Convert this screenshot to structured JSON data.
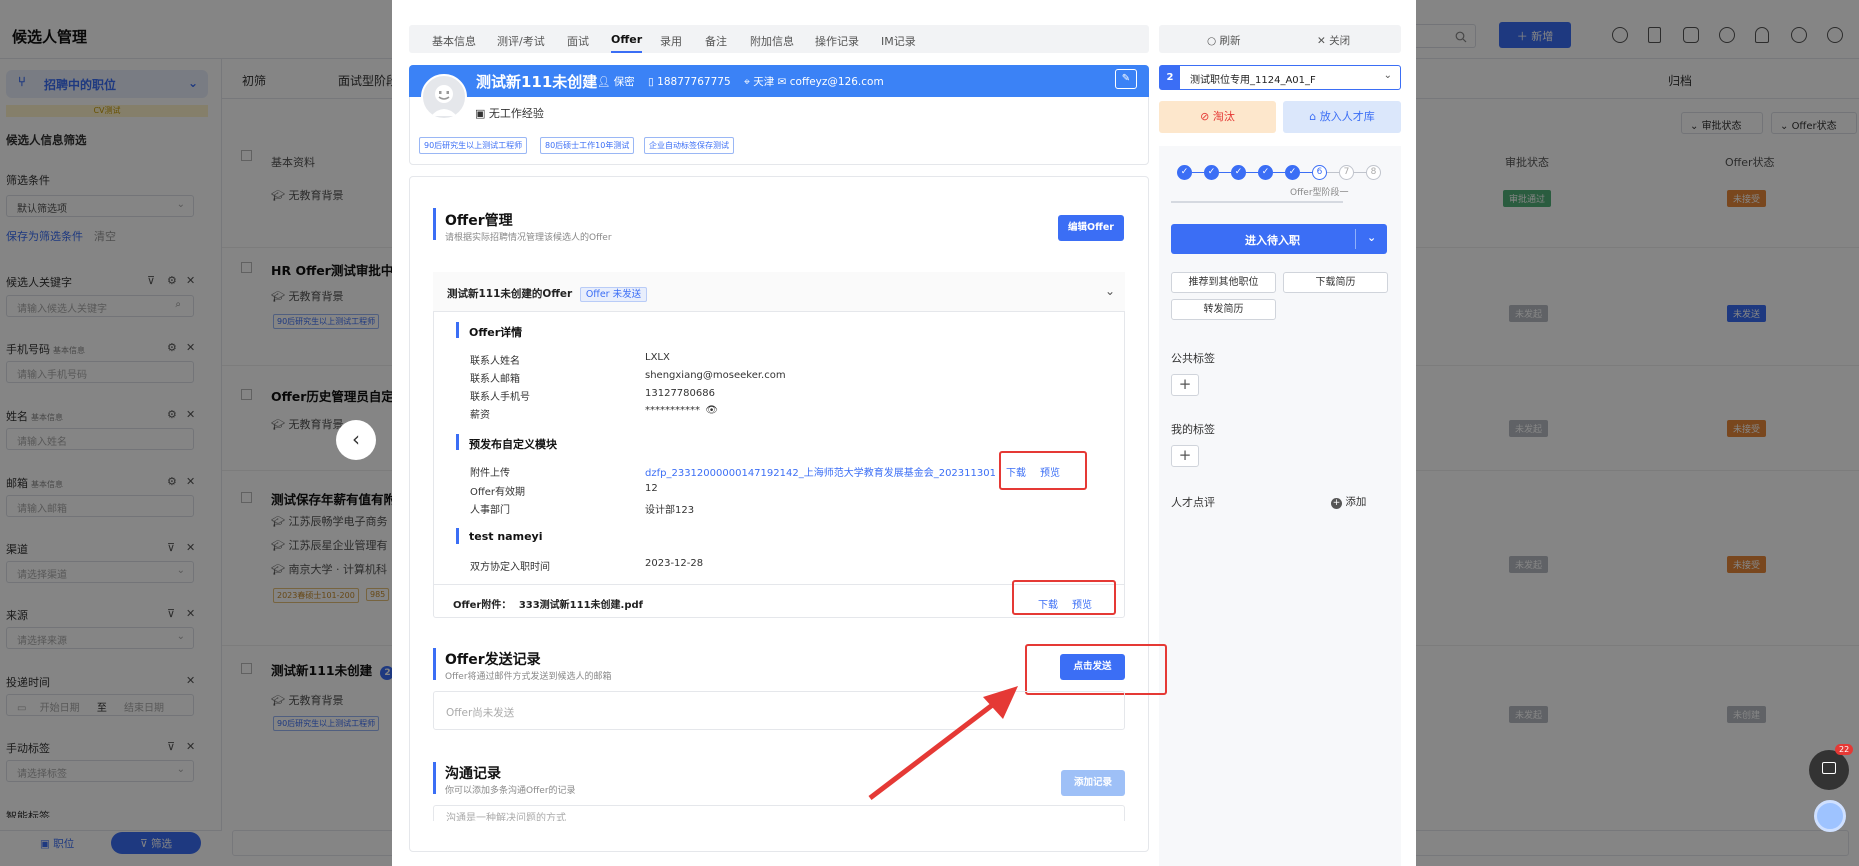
{
  "app": {
    "title": "候选人管理"
  },
  "header_right": {
    "new_button": "新增"
  },
  "sidebar": {
    "job_select": "招聘中的职位",
    "cv_tag": "CV测试",
    "section_title": "候选人信息筛选",
    "filter_condition_label": "筛选条件",
    "filter_default": "默认筛选项",
    "save_filter": "保存为筛选条件",
    "clear": "清空",
    "fields": [
      {
        "label": "候选人关键字",
        "small": "",
        "placeholder": "请输入候选人关键字"
      },
      {
        "label": "手机号码",
        "small": "基本信息",
        "placeholder": "请输入手机号码"
      },
      {
        "label": "姓名",
        "small": "基本信息",
        "placeholder": "请输入姓名"
      },
      {
        "label": "邮箱",
        "small": "基本信息",
        "placeholder": "请输入邮箱"
      },
      {
        "label": "渠道",
        "small": "",
        "placeholder": "请选择渠道"
      },
      {
        "label": "来源",
        "small": "",
        "placeholder": "请选择来源"
      },
      {
        "label": "投递时间",
        "small": "",
        "placeholder": ""
      },
      {
        "label": "手动标签",
        "small": "",
        "placeholder": "请选择标签"
      },
      {
        "label": "智能标签",
        "small": "",
        "placeholder": ""
      }
    ],
    "date_start": "开始日期",
    "date_to": "至",
    "date_end": "结束日期",
    "nav_job": "职位",
    "nav_filter": "筛选"
  },
  "pipeline": {
    "stage1": "初筛",
    "stage2": "面试型阶段",
    "archive": "归档"
  },
  "list": {
    "col_basic": "基本资料",
    "col_approval": "审批状态",
    "col_offer": "Offer状态",
    "filter_approval": "审批状态",
    "filter_offer": "Offer状态",
    "rows": [
      {
        "name": "",
        "edu": "无教育背景",
        "approval": "审批通过",
        "offer": "未接受"
      },
      {
        "name": "HR Offer测试审批中",
        "edu": "无教育背景",
        "tag": "90后研究生以上测试工程师",
        "approval": "未发起",
        "offer": "未发送"
      },
      {
        "name": "Offer历史管理员自定",
        "edu": "无教育背景",
        "approval": "未发起",
        "offer": "未接受"
      },
      {
        "name": "测试保存年薪有值有附",
        "edu": "江苏辰畅学电子商务",
        "edu2": "江苏辰星企业管理有",
        "edu3": "南京大学 · 计算机科",
        "tag": "2023春硕士101-200",
        "tag2": "985",
        "approval": "未发起",
        "offer": "未接受"
      },
      {
        "name": "测试新111未创建",
        "badge": "2",
        "edu": "无教育背景",
        "tag": "90后研究生以上测试工程师",
        "approval": "未发起",
        "offer": "未创建"
      }
    ]
  },
  "modal": {
    "tabs": [
      "基本信息",
      "测评/考试",
      "面试",
      "Offer",
      "录用",
      "备注",
      "附加信息",
      "操作记录",
      "IM记录"
    ],
    "refresh": "刷新",
    "close": "关闭",
    "candidate": {
      "name": "测试新111未创建",
      "privacy": "保密",
      "phone": "18877767775",
      "city": "天津",
      "email": "coffeyz@126.com",
      "experience": "无工作经验",
      "tags": [
        "90后研究生以上测试工程师",
        "80后硕士工作10年测试",
        "企业自动标签保存测试"
      ]
    },
    "offer_mgmt": {
      "title": "Offer管理",
      "subtitle": "请根据实际招聘情况管理该候选人的Offer",
      "edit_btn": "编辑Offer",
      "card_title": "测试新111未创建的Offer",
      "card_status": "Offer 未发送",
      "details_title": "Offer详情",
      "details": [
        {
          "label": "联系人姓名",
          "value": "LXLX"
        },
        {
          "label": "联系人邮箱",
          "value": "shengxiang@moseeker.com"
        },
        {
          "label": "联系人手机号",
          "value": "13127780686"
        },
        {
          "label": "薪资",
          "value": "***********"
        }
      ],
      "custom_title": "预发布自定义模块",
      "attach_label": "附件上传",
      "attach_file": "dzfp_23312000000147192142_上海师范大学教育发展基金会_202311301...",
      "download": "下载",
      "preview": "预览",
      "validity_label": "Offer有效期",
      "validity_value": "12",
      "hr_label": "人事部门",
      "hr_value": "设计部123",
      "test_title": "test nameyi",
      "date_label": "双方协定入职时间",
      "date_value": "2023-12-28",
      "attachment_label": "Offer附件：",
      "attachment_file": "333测试新111未创建.pdf"
    },
    "send_record": {
      "title": "Offer发送记录",
      "subtitle": "Offer将通过邮件方式发送到候选人的邮箱",
      "send_btn": "点击发送",
      "empty": "Offer尚未发送"
    },
    "comm": {
      "title": "沟通记录",
      "subtitle": "你可以添加多条沟通Offer的记录",
      "add_btn": "添加记录",
      "placeholder": "沟通是一种解决问题的方式"
    },
    "right": {
      "job_index": "2",
      "job_name": "测试职位专用_1124_A01_F",
      "eliminate": "淘汰",
      "talent_pool": "放入人才库",
      "steps_done": [
        "✓",
        "✓",
        "✓",
        "✓",
        "✓"
      ],
      "step_current": "6",
      "steps_todo": [
        "7",
        "8"
      ],
      "stage_label": "Offer型阶段一",
      "enter_btn": "进入待入职",
      "recommend": "推荐到其他职位",
      "download_cv": "下载简历",
      "forward_cv": "转发简历",
      "public_tags": "公共标签",
      "my_tags": "我的标签",
      "comment": "人才点评",
      "add": "添加"
    }
  },
  "chat_badge": "22",
  "colors": {
    "primary": "#3b6ef5",
    "danger": "#e53935",
    "header": "#3b82f6"
  }
}
